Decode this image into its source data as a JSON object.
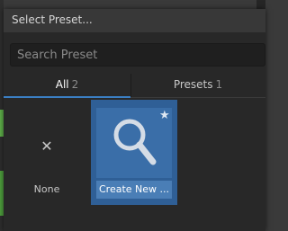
{
  "dialog": {
    "title": "Select Preset..."
  },
  "search": {
    "placeholder": "Search Preset",
    "value": ""
  },
  "tabs": [
    {
      "label": "All",
      "count": "2"
    },
    {
      "label": "Presets",
      "count": "1"
    }
  ],
  "items": [
    {
      "label": "None",
      "icon": "close-icon"
    },
    {
      "label": "Create New ...",
      "icon": "search-icon",
      "badge": "star-icon"
    }
  ],
  "colors": {
    "accent": "#3b7fc4",
    "selected_tile": "#2f5f96"
  }
}
